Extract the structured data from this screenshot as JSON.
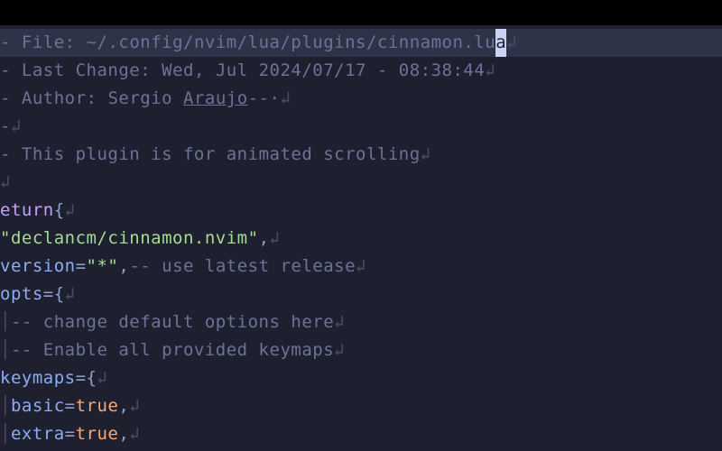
{
  "file_path": "~/.config/nvim/lua/plugins/cinnamon.lu",
  "cursor_char": "a",
  "last_change_label": "Last Change:",
  "last_change_value": "Wed, Jul 2024/07/17 - 08:38:44",
  "author_label": "Author:",
  "author_name": "Sergio",
  "author_surname": "Araujo",
  "plugin_desc": "This plugin is for animated scrolling",
  "keyword_return": "eturn",
  "plugin_name": "declancm/cinnamon.nvim",
  "version_key": "version",
  "version_val": "\"*\"",
  "version_comment": "use latest release",
  "opts_key": "opts",
  "opts_comment1": "change default options here",
  "opts_comment2": "Enable all provided keymaps",
  "keymaps_key": "keymaps",
  "basic_key": "basic",
  "basic_val": "true",
  "extra_key": "extra",
  "extra_val": "true",
  "eol_marker": "↲",
  "dash": "-",
  "file_label": "File:",
  "indent_char": "│"
}
